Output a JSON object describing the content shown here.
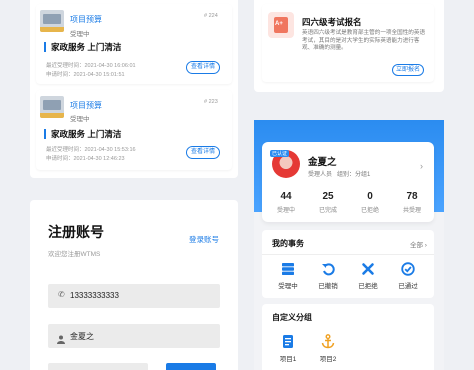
{
  "list": {
    "items": [
      {
        "title": "项目预算",
        "no": "# 224",
        "status": "受理中",
        "subject": "家政服务 上门清洁",
        "time1": "最近受理时间：2021-04-30 16:06:01",
        "time2": "申请时间：2021-04-30 15:01:51",
        "button": "查看详情"
      },
      {
        "title": "项目预算",
        "no": "# 223",
        "status": "受理中",
        "subject": "家政服务 上门清洁",
        "time1": "最近受理时间：2021-04-30 15:53:16",
        "time2": "申请时间：2021-04-30 12:46:23",
        "button": "查看详情"
      }
    ]
  },
  "exam": {
    "icon_text": "A+",
    "title": "四六级考试报名",
    "desc": "英语四六级考试是教育部主管的一项全国性的英语考试，其目的是对大学生的实际英语能力进行客观、准确的测量。",
    "button": "立即报名"
  },
  "register": {
    "title": "注册账号",
    "login_link": "登录账号",
    "subtitle": "欢迎您注册WTMS",
    "phone": "13333333333",
    "name": "金夏之"
  },
  "profile": {
    "badge": "已认证",
    "name": "金夏之",
    "role": "受理人员",
    "group": "组别：分组1",
    "stats": [
      {
        "num": "44",
        "label": "受理中"
      },
      {
        "num": "25",
        "label": "已完成"
      },
      {
        "num": "0",
        "label": "已拒绝"
      },
      {
        "num": "78",
        "label": "共受理"
      }
    ]
  },
  "affairs": {
    "title": "我的事务",
    "all": "全部",
    "items": [
      {
        "label": "受理中",
        "icon": "server-icon"
      },
      {
        "label": "已撤销",
        "icon": "undo-icon"
      },
      {
        "label": "已拒绝",
        "icon": "x-icon"
      },
      {
        "label": "已通过",
        "icon": "check-circle-icon"
      }
    ]
  },
  "custom": {
    "title": "自定义分组",
    "items": [
      {
        "label": "项目1",
        "icon": "document-icon"
      },
      {
        "label": "项目2",
        "icon": "anchor-icon"
      }
    ]
  },
  "colors": {
    "accent": "#1a7be6",
    "background": "#eef0f4",
    "danger": "#e74c3c"
  }
}
